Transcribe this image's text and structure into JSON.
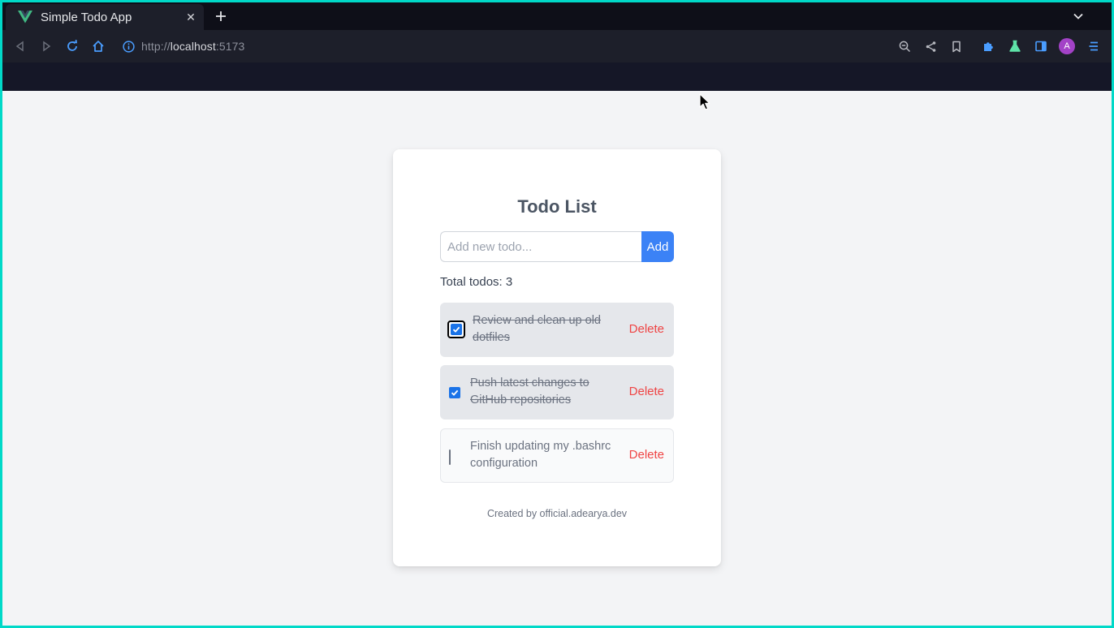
{
  "browser": {
    "tab_title": "Simple Todo App",
    "tab_close": "✕",
    "url_scheme": "http://",
    "url_host": "localhost",
    "url_port": ":5173",
    "profile_initial": "A"
  },
  "app": {
    "title": "Todo List",
    "input_placeholder": "Add new todo...",
    "input_value": "",
    "add_label": "Add",
    "total_label": "Total todos: 3",
    "footer": "Created by official.adearya.dev",
    "todos": [
      {
        "text": "Review and clean up old dotfiles",
        "completed": true,
        "delete_label": "Delete"
      },
      {
        "text": "Push latest changes to GitHub repositories",
        "completed": true,
        "delete_label": "Delete"
      },
      {
        "text": "Finish updating my .bashrc configuration",
        "completed": false,
        "delete_label": "Delete"
      }
    ]
  },
  "icons": {
    "tab_logo": "vue-logo-icon",
    "new_tab": "plus-icon",
    "tab_list": "chevron-down-icon",
    "back": "arrow-left-icon",
    "forward": "arrow-right-icon",
    "reload": "reload-icon",
    "home": "home-icon",
    "site_info": "info-icon",
    "zoom": "zoom-icon",
    "share": "share-icon",
    "bookmark": "bookmark-icon",
    "extensions": "puzzle-icon",
    "labs": "flask-icon",
    "sidebar": "sidebar-icon",
    "menu": "menu-icon"
  },
  "colors": {
    "accent": "#3b82f6",
    "delete": "#ef4444",
    "completed_bg": "#e5e7eb",
    "page_bg": "#f3f4f6",
    "browser_frame": "#00d9c8"
  }
}
